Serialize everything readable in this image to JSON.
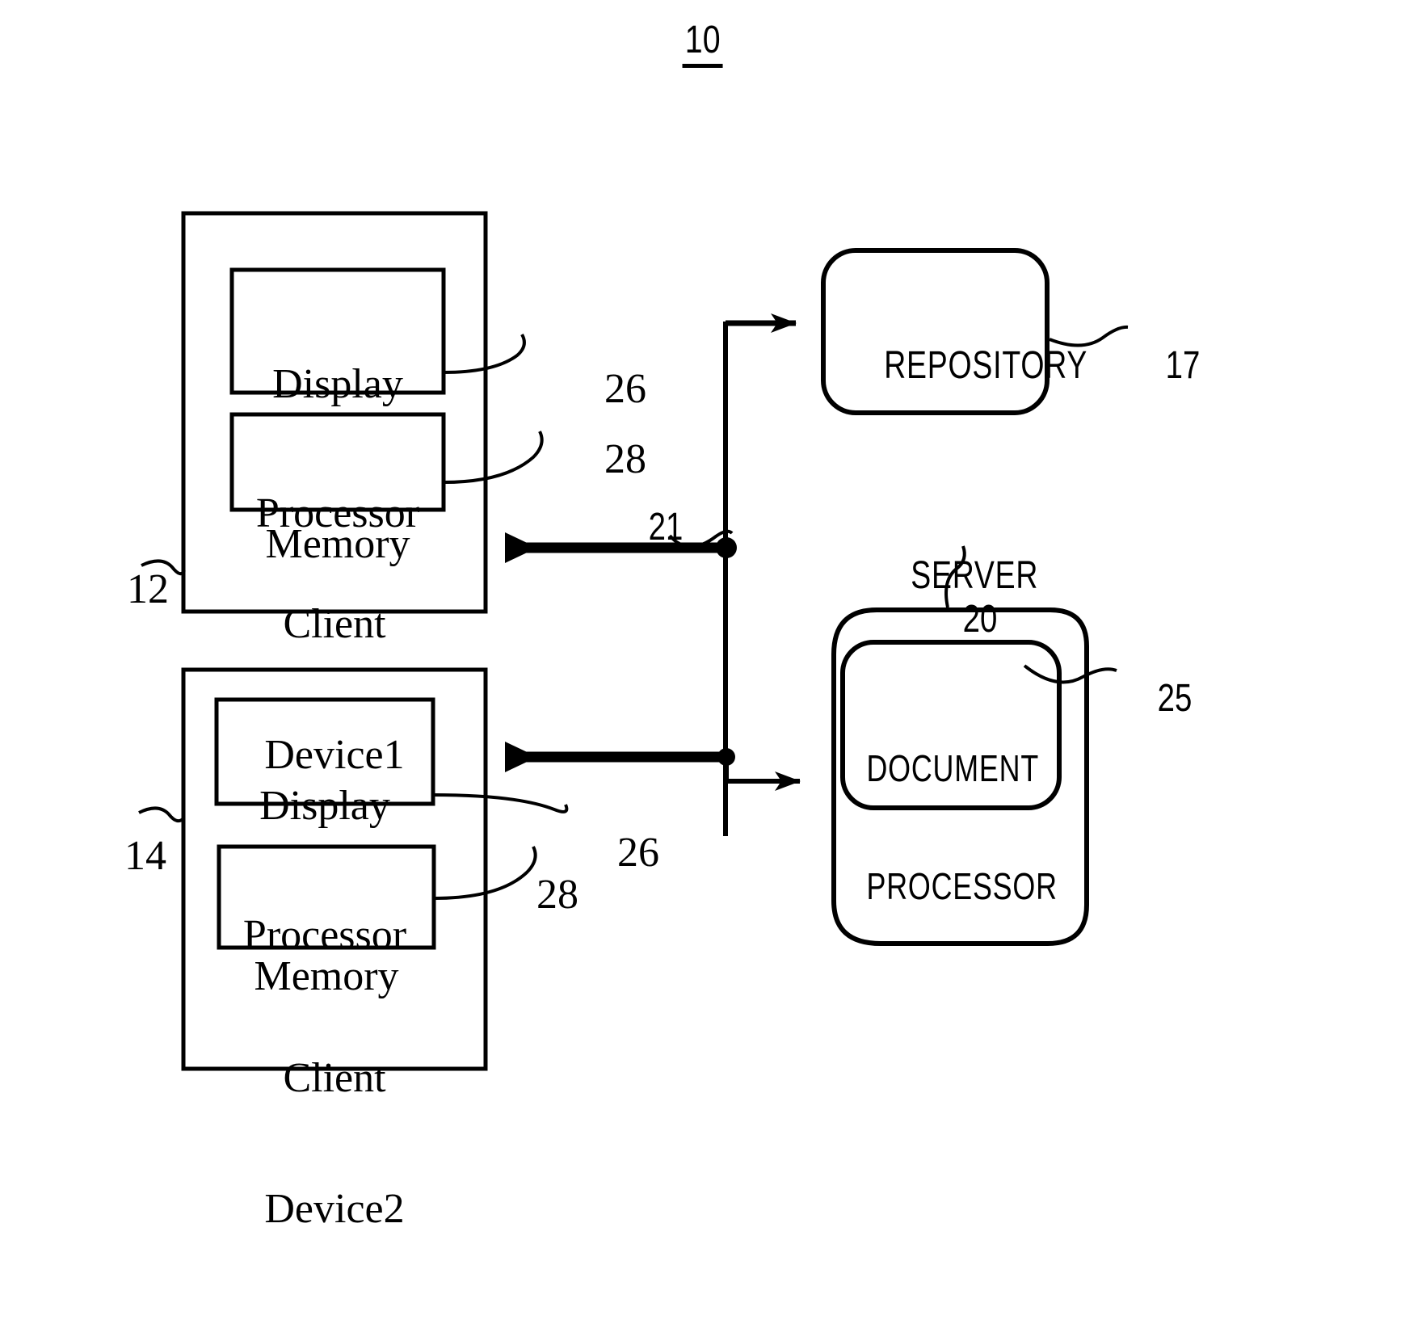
{
  "figure": {
    "number": "10"
  },
  "client_device_1": {
    "ref": "12",
    "title_line1": "Client",
    "title_line2": "Device1",
    "display_processor": {
      "ref": "26",
      "line1": "Display",
      "line2": "Processor"
    },
    "memory": {
      "ref": "28",
      "label": "Memory"
    }
  },
  "client_device_2": {
    "ref": "14",
    "title_line1": "Client",
    "title_line2": "Device2",
    "display_processor": {
      "ref": "26",
      "line1": "Display",
      "line2": "Processor"
    },
    "memory": {
      "ref": "28",
      "label": "Memory"
    }
  },
  "repository": {
    "ref": "17",
    "label": "REPOSITORY"
  },
  "server": {
    "ref": "20",
    "label": "SERVER",
    "document_processor": {
      "ref": "25",
      "line1": "DOCUMENT",
      "line2": "PROCESSOR"
    }
  },
  "network": {
    "ref": "21"
  },
  "colors": {
    "ink": "#000000",
    "paper": "#ffffff"
  }
}
